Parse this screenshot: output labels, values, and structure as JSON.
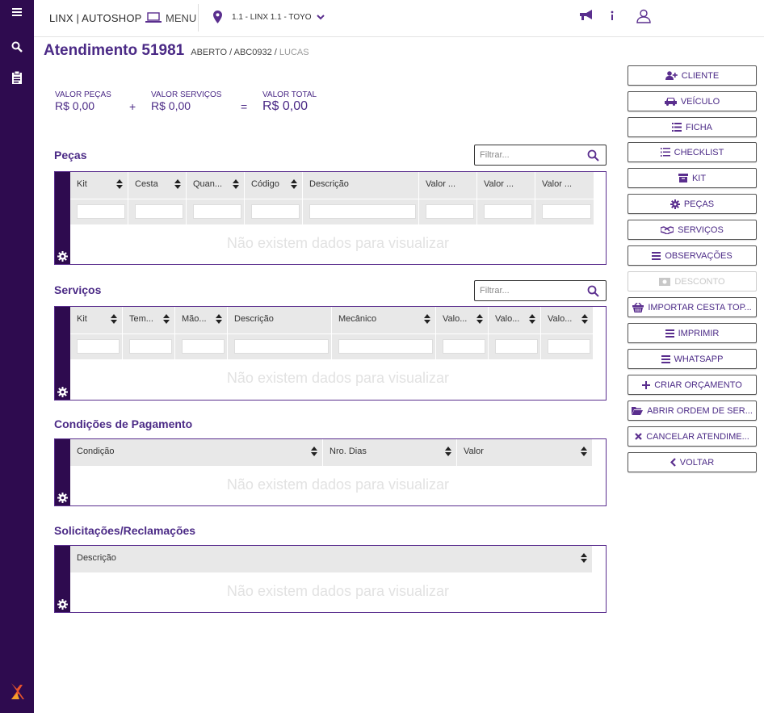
{
  "app": {
    "brand": "LINX | AUTOSHOP",
    "menu_label": "MENU",
    "store_label": "1.1 - LINX 1.1 - TOYO"
  },
  "header": {
    "title": "Atendimento 51981",
    "status": "ABERTO / ABC0932 / ",
    "user": "LUCAS"
  },
  "totals": {
    "pecas_label": "VALOR PEÇAS",
    "pecas_value": "R$ 0,00",
    "servicos_label": "VALOR SERVIÇOS",
    "servicos_value": "R$ 0,00",
    "total_label": "VALOR TOTAL",
    "total_value": "R$ 0,00",
    "plus": "+",
    "equals": "="
  },
  "empty_text": "Não existem dados para visualizar",
  "sections": {
    "pecas": {
      "title": "Peças",
      "filter_placeholder": "Filtrar...",
      "columns": [
        "Kit",
        "Cesta",
        "Quan...",
        "Código",
        "Descrição",
        "Valor ...",
        "Valor ...",
        "Valor ..."
      ]
    },
    "servicos": {
      "title": "Serviços",
      "filter_placeholder": "Filtrar...",
      "columns": [
        "Kit",
        "Tem...",
        "Mão...",
        "Descrição",
        "Mecânico",
        "Valo...",
        "Valo...",
        "Valo..."
      ]
    },
    "pagamento": {
      "title": "Condições de Pagamento",
      "columns": [
        "Condição",
        "Nro. Dias",
        "Valor"
      ]
    },
    "solicitacoes": {
      "title": "Solicitações/Reclamações",
      "columns": [
        "Descrição"
      ]
    }
  },
  "actions": [
    {
      "label": "CLIENTE",
      "icon": "user-plus-icon",
      "enabled": true
    },
    {
      "label": "VEÍCULO",
      "icon": "car-icon",
      "enabled": true
    },
    {
      "label": "FICHA",
      "icon": "list-icon",
      "enabled": true
    },
    {
      "label": "CHECKLIST",
      "icon": "list-ol-icon",
      "enabled": true
    },
    {
      "label": "KIT",
      "icon": "archive-icon",
      "enabled": true
    },
    {
      "label": "PEÇAS",
      "icon": "cog-icon",
      "enabled": true
    },
    {
      "label": "SERVIÇOS",
      "icon": "handshake-icon",
      "enabled": true
    },
    {
      "label": "OBSERVAÇÕES",
      "icon": "bars-icon",
      "enabled": true
    },
    {
      "label": "DESCONTO",
      "icon": "money-icon",
      "enabled": false
    },
    {
      "label": "IMPORTAR CESTA TOP...",
      "icon": "basket-icon",
      "enabled": true
    },
    {
      "label": "IMPRIMIR",
      "icon": "bars-icon",
      "enabled": true
    },
    {
      "label": "WHATSAPP",
      "icon": "bars-icon",
      "enabled": true
    },
    {
      "label": "CRIAR ORÇAMENTO",
      "icon": "plus-icon",
      "enabled": true
    },
    {
      "label": "ABRIR ORDEM DE SER...",
      "icon": "folder-open-icon",
      "enabled": true
    },
    {
      "label": "CANCELAR ATENDIME...",
      "icon": "times-icon",
      "enabled": true
    },
    {
      "label": "VOLTAR",
      "icon": "chevron-left-icon",
      "enabled": true
    }
  ],
  "colors": {
    "sidebar": "#2e0b4f",
    "accent": "#4b2a86",
    "header_row": "#e8e8e8"
  }
}
